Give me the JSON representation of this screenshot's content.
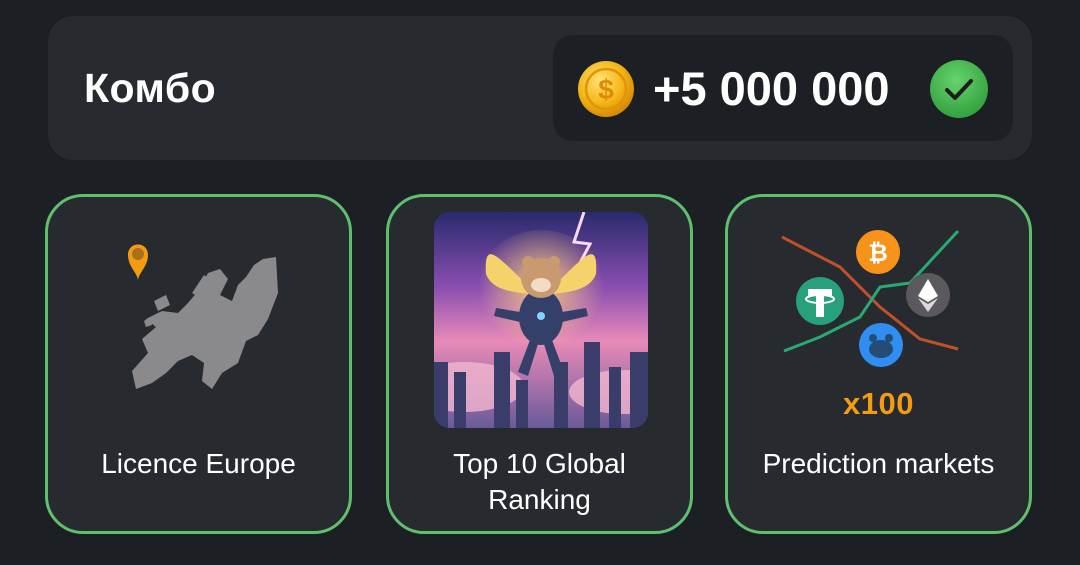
{
  "combo": {
    "title": "Комбо",
    "reward": "+5 000 000",
    "status": "completed"
  },
  "cards": [
    {
      "label": "Licence Europe",
      "icon": "europe-map-icon"
    },
    {
      "label": "Top 10 Global Ranking",
      "icon": "hamster-astronaut-image"
    },
    {
      "label": "Prediction markets",
      "icon": "crypto-chart-icon",
      "multiplier": "x100"
    }
  ],
  "colors": {
    "background": "#1c1f24",
    "panel": "#272a2f",
    "card_border": "#5fbf6d",
    "check": "#4caf50",
    "coin": "#f5c842",
    "accent_orange": "#f39c12"
  }
}
